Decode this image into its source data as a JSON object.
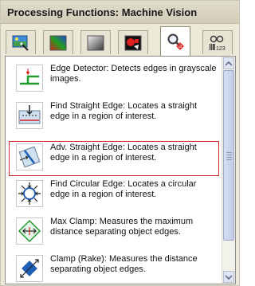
{
  "title": "Processing Functions: Machine Vision",
  "tabs": [
    {
      "icon": "image-wand-icon"
    },
    {
      "icon": "color-gradient-icon"
    },
    {
      "icon": "grayscale-gradient-icon"
    },
    {
      "icon": "particle-analysis-icon"
    },
    {
      "icon": "magnifier-measure-icon",
      "active": true
    },
    {
      "icon": "identification-barcode-icon"
    }
  ],
  "items": [
    {
      "icon": "edge-detector-icon",
      "text": "Edge Detector:  Detects edges in grayscale images."
    },
    {
      "icon": "find-straight-edge-icon",
      "text": "Find Straight Edge:  Locates a straight edge in a region of interest."
    },
    {
      "icon": "adv-straight-edge-icon",
      "text": "Adv. Straight Edge:  Locates a straight edge in a region of interest.",
      "selected": true
    },
    {
      "icon": "find-circular-edge-icon",
      "text": "Find Circular Edge:  Locates a circular edge in a region of interest."
    },
    {
      "icon": "max-clamp-icon",
      "text": "Max Clamp:  Measures the maximum distance separating object edges."
    },
    {
      "icon": "clamp-rake-icon",
      "text": "Clamp (Rake):  Measures the distance separating object edges."
    }
  ],
  "tab_digits": "123"
}
